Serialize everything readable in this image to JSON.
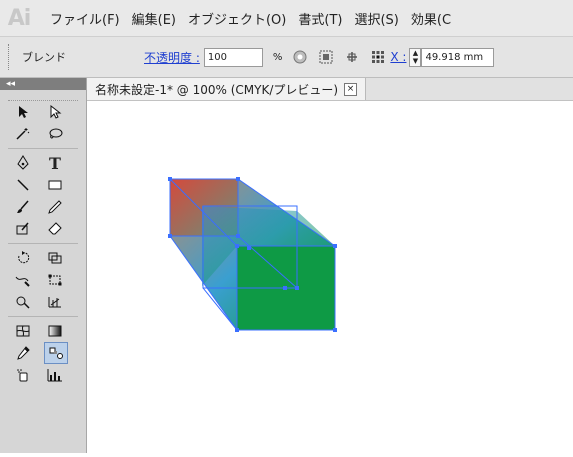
{
  "app": {
    "logo": "Ai"
  },
  "menu": [
    "ファイル(F)",
    "編集(E)",
    "オブジェクト(O)",
    "書式(T)",
    "選択(S)",
    "効果(C"
  ],
  "control_bar": {
    "object_type": "ブレンド",
    "opacity_label": "不透明度 :",
    "opacity_value": "100",
    "percent": "%",
    "x_label": "X :",
    "x_value": "49.918 mm"
  },
  "tool_panel": {
    "collapse": "◂◂"
  },
  "document": {
    "tab_title": "名称未設定-1* @ 100% (CMYK/プレビュー)",
    "close_glyph": "×"
  },
  "colors": {
    "back_red": "#d44a3c",
    "front_blue": "#2f8fe3",
    "front_green": "#0e9a45",
    "selection": "#3a6fff"
  },
  "tools": [
    [
      "selection-tool",
      "direct-selection-tool"
    ],
    [
      "magic-wand-tool",
      "lasso-tool"
    ],
    [
      "pen-tool",
      "type-tool"
    ],
    [
      "line-tool",
      "rectangle-tool"
    ],
    [
      "paintbrush-tool",
      "pencil-tool"
    ],
    [
      "blob-brush-tool",
      "eraser-tool"
    ],
    [
      "rotate-tool",
      "scale-tool"
    ],
    [
      "warp-tool",
      "free-transform-tool"
    ],
    [
      "shape-builder-tool",
      "perspective-grid-tool"
    ],
    [
      "mesh-tool",
      "gradient-tool"
    ],
    [
      "eyedropper-tool",
      "blend-tool"
    ],
    [
      "symbol-sprayer-tool",
      "column-graph-tool"
    ]
  ]
}
